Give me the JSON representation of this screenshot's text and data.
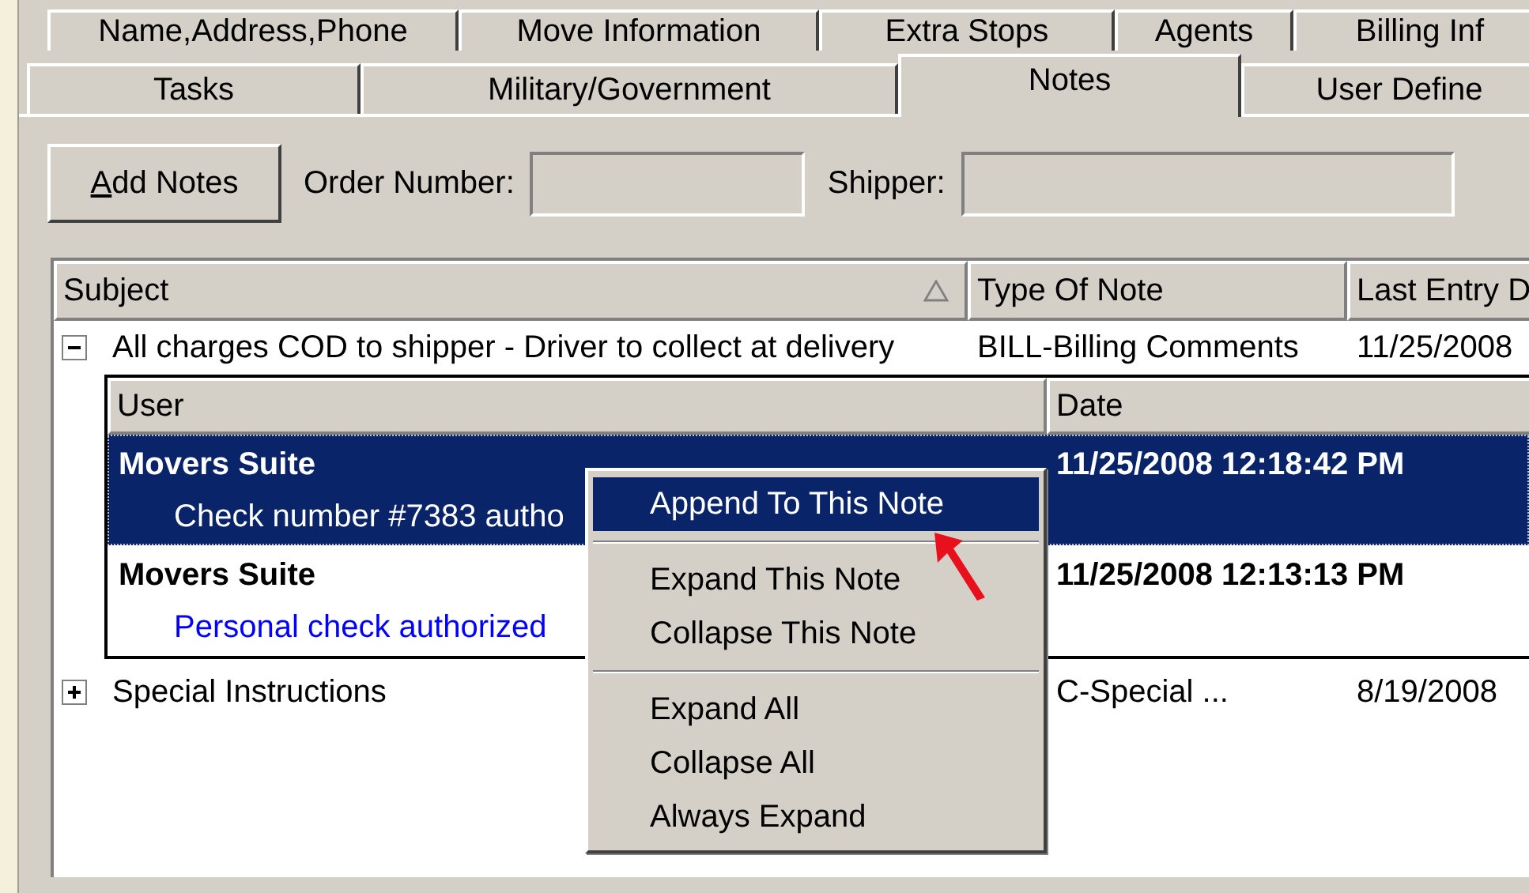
{
  "tab_rows": [
    {
      "tabs": [
        {
          "label": "Name,Address,Phone",
          "selected": false
        },
        {
          "label": "Move Information",
          "selected": false
        },
        {
          "label": "Extra Stops",
          "selected": false
        },
        {
          "label": "Agents",
          "selected": false
        },
        {
          "label": "Billing Inf",
          "selected": false
        }
      ]
    },
    {
      "tabs": [
        {
          "label": "Tasks",
          "selected": false
        },
        {
          "label": "Military/Government",
          "selected": false
        },
        {
          "label": "Notes",
          "selected": true
        },
        {
          "label": "User Define",
          "selected": false
        }
      ]
    }
  ],
  "toolbar": {
    "add_button": {
      "label": "Add Notes"
    },
    "order_number": {
      "label": "Order Number:"
    },
    "shipper": {
      "label": "Shipper:"
    }
  },
  "grid": {
    "columns": [
      {
        "label": "Subject",
        "sorted": true
      },
      {
        "label": "Type Of Note"
      },
      {
        "label": "Last Entry D"
      }
    ],
    "rows": [
      {
        "subject": "All charges COD to shipper - Driver to collect at delivery",
        "type": "BILL-Billing Comments",
        "last_entry": "11/25/2008",
        "expanded": true,
        "detail": {
          "columns": [
            "User",
            "Date"
          ],
          "notes": [
            {
              "user": "Movers Suite",
              "date": "11/25/2008 12:18:42 PM",
              "text": "Check number #7383 autho",
              "selected": true
            },
            {
              "user": "Movers Suite",
              "date": "11/25/2008 12:13:13 PM",
              "text": "Personal check authorized",
              "selected": false,
              "color": "#0000ff"
            }
          ]
        }
      },
      {
        "subject": "Special Instructions",
        "type": "C-Special ...",
        "last_entry": "8/19/2008",
        "expanded": false
      }
    ]
  },
  "context_menu": {
    "items": [
      {
        "kind": "item",
        "label": "Append To This Note",
        "selected": true
      },
      {
        "kind": "separator"
      },
      {
        "kind": "item",
        "label": "Expand This Note",
        "selected": false
      },
      {
        "kind": "item",
        "label": "Collapse This Note",
        "selected": false
      },
      {
        "kind": "separator"
      },
      {
        "kind": "item",
        "label": "Expand All",
        "selected": false
      },
      {
        "kind": "item",
        "label": "Collapse All",
        "selected": false
      },
      {
        "kind": "item",
        "label": "Always Expand",
        "selected": false
      }
    ]
  }
}
